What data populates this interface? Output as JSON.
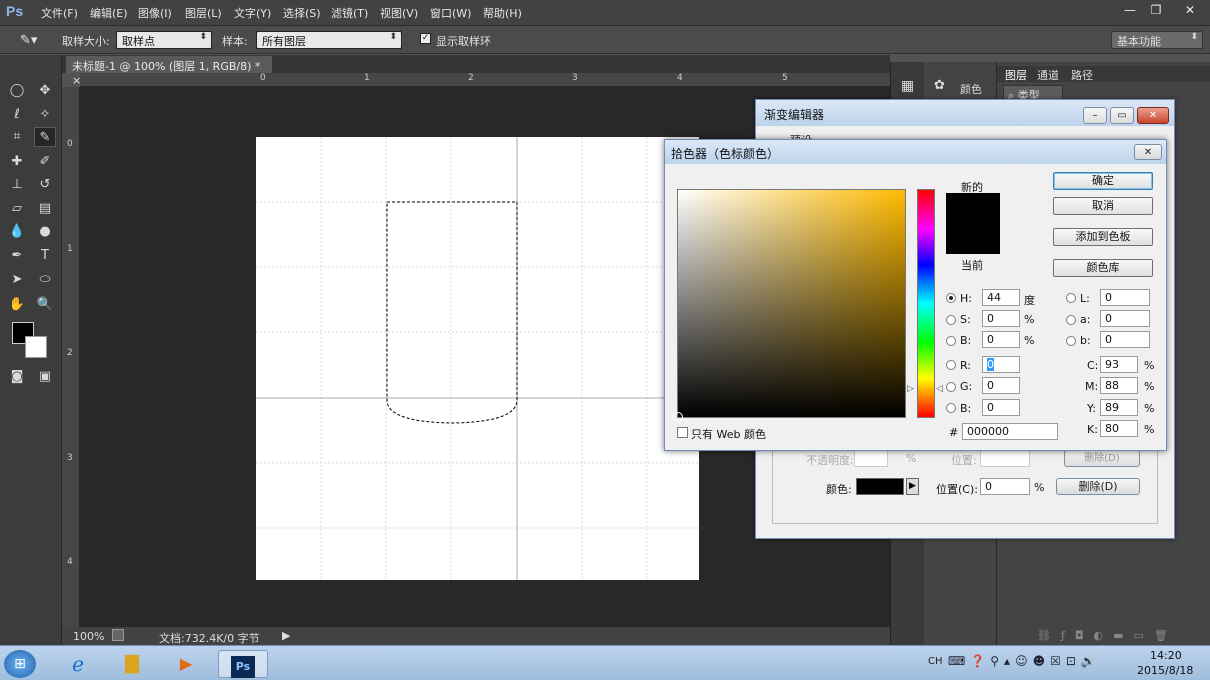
{
  "app": {
    "logo": "Ps"
  },
  "menu": [
    "文件(F)",
    "编辑(E)",
    "图像(I)",
    "图层(L)",
    "文字(Y)",
    "选择(S)",
    "滤镜(T)",
    "视图(V)",
    "窗口(W)",
    "帮助(H)"
  ],
  "window_controls": [
    "—",
    "❐",
    "✕"
  ],
  "options": {
    "sample_size_label": "取样大小:",
    "sample_size_value": "取样点",
    "sample_label": "样本:",
    "sample_value": "所有图层",
    "show_ring_label": "显示取样环",
    "workspace": "基本功能"
  },
  "document": {
    "tab_title": "未标题-1 @ 100% (图层 1, RGB/8) *",
    "ruler_top": [
      "0",
      "1",
      "2",
      "3",
      "4",
      "5"
    ],
    "ruler_left": [
      "0",
      "1",
      "2",
      "3",
      "4"
    ]
  },
  "status": {
    "zoom": "100%",
    "doc_info": "文档:732.4K/0 字节"
  },
  "panels": {
    "color_tab": "颜色",
    "layers_tab": "图层",
    "channels_tab": "通道",
    "paths_tab": "路径",
    "filter_kind": "类型"
  },
  "gradient_editor": {
    "title": "渐变编辑器",
    "preset_label": "预设",
    "opacity_label": "不透明度:",
    "opacity_unit": "%",
    "position_label": "位置:",
    "delete_label": "删除(D)",
    "color_label": "颜色:",
    "position_c_label": "位置(C):",
    "position_value": "0",
    "position_unit": "%",
    "delete2_label": "删除(D)"
  },
  "color_picker": {
    "title": "拾色器（色标颜色）",
    "new_label": "新的",
    "current_label": "当前",
    "ok": "确定",
    "cancel": "取消",
    "add_swatch": "添加到色板",
    "color_libs": "颜色库",
    "hsb": [
      {
        "k": "H:",
        "v": "44",
        "u": "度"
      },
      {
        "k": "S:",
        "v": "0",
        "u": "%"
      },
      {
        "k": "B:",
        "v": "0",
        "u": "%"
      }
    ],
    "rgb": [
      {
        "k": "R:",
        "v": "0"
      },
      {
        "k": "G:",
        "v": "0"
      },
      {
        "k": "B:",
        "v": "0"
      }
    ],
    "lab": [
      {
        "k": "L:",
        "v": "0"
      },
      {
        "k": "a:",
        "v": "0"
      },
      {
        "k": "b:",
        "v": "0"
      }
    ],
    "cmyk": [
      {
        "k": "C:",
        "v": "93",
        "u": "%"
      },
      {
        "k": "M:",
        "v": "88",
        "u": "%"
      },
      {
        "k": "Y:",
        "v": "89",
        "u": "%"
      },
      {
        "k": "K:",
        "v": "80",
        "u": "%"
      }
    ],
    "web_only": "只有 Web 颜色",
    "hex_label": "#",
    "hex": "000000",
    "new_color": "#000000",
    "current_color": "#000000"
  },
  "taskbar": {
    "lang": "CH",
    "time": "14:20",
    "date": "2015/8/18"
  }
}
